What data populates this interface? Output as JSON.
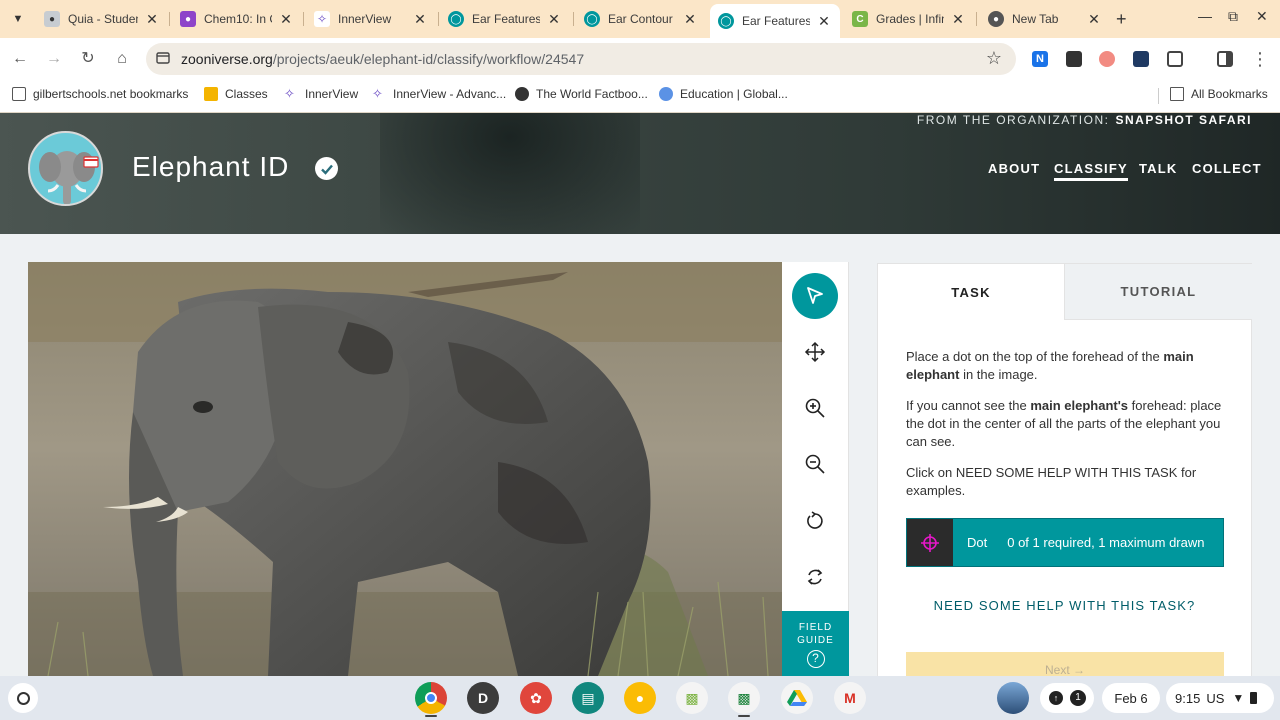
{
  "browser": {
    "tabs": [
      {
        "title": "Quia - Studen",
        "favicon": "quia-icon",
        "color": "#7a8a9a"
      },
      {
        "title": "Chem10: In C",
        "favicon": "classroom-icon",
        "color": "#8e44c9"
      },
      {
        "title": "InnerView",
        "favicon": "innerview-icon",
        "color": "#6a4bc4"
      },
      {
        "title": "Ear Features",
        "favicon": "zooniverse-icon",
        "color": "#00979d"
      },
      {
        "title": "Ear Contour",
        "favicon": "zooniverse-icon",
        "color": "#00979d"
      },
      {
        "title": "Ear Features",
        "favicon": "zooniverse-icon",
        "color": "#00979d",
        "active": true
      },
      {
        "title": "Grades | Infin",
        "favicon": "infinite-campus-icon",
        "color": "#7ab648"
      },
      {
        "title": "New Tab",
        "favicon": "chrome-icon",
        "color": "#555555"
      }
    ],
    "url_host": "zooniverse.org",
    "url_path": "/projects/aeuk/elephant-id/classify/workflow/24547",
    "bookmarks": [
      {
        "label": "gilbertschools.net bookmarks",
        "icon": "folder-link-icon"
      },
      {
        "label": "Classes",
        "icon": "classroom-icon"
      },
      {
        "label": "InnerView",
        "icon": "innerview-icon"
      },
      {
        "label": "InnerView - Advanc...",
        "icon": "innerview-icon"
      },
      {
        "label": "The World Factboo...",
        "icon": "cia-seal-icon"
      },
      {
        "label": "Education | Global...",
        "icon": "un-icon"
      }
    ],
    "all_bookmarks": "All Bookmarks"
  },
  "project": {
    "organization_prefix": "FROM THE ORGANIZATION:",
    "organization_name": "SNAPSHOT SAFARI",
    "title": "Elephant ID",
    "nav": [
      "ABOUT",
      "CLASSIFY",
      "TALK",
      "COLLECT"
    ],
    "active_nav": "CLASSIFY"
  },
  "viewer": {
    "tools": [
      "pointer-icon",
      "move-icon",
      "zoom-in-icon",
      "zoom-out-icon",
      "rotate-icon",
      "reset-icon"
    ],
    "field_guide_line1": "FIELD",
    "field_guide_line2": "GUIDE",
    "field_guide_q": "?"
  },
  "task": {
    "tab_task": "TASK",
    "tab_tutorial": "TUTORIAL",
    "p1_a": "Place a dot on the top of the forehead of the ",
    "p1_b": "main elephant",
    "p1_c": " in the image.",
    "p2_a": "If you cannot see the ",
    "p2_b": "main elephant's",
    "p2_c": " forehead: place the dot in the center of all the parts of the elephant you can see.",
    "p3": "Click on NEED SOME HELP WITH THIS TASK for examples.",
    "tool_label": "Dot",
    "tool_count": "0 of 1 required, 1 maximum drawn",
    "need_help": "NEED SOME HELP WITH THIS TASK?",
    "next": "Next →"
  },
  "shelf": {
    "apps": [
      {
        "name": "chrome-app",
        "letter": ""
      },
      {
        "name": "account-app",
        "letter": "D"
      },
      {
        "name": "canvas-app",
        "letter": ""
      },
      {
        "name": "classroom-app",
        "letter": ""
      },
      {
        "name": "keep-app",
        "letter": ""
      },
      {
        "name": "slides-app",
        "letter": ""
      },
      {
        "name": "classroom-green-app",
        "letter": ""
      },
      {
        "name": "drive-app",
        "letter": ""
      },
      {
        "name": "gmail-app",
        "letter": "M"
      }
    ],
    "notification_count": "1",
    "date": "Feb 6",
    "time": "9:15",
    "locale": "US"
  }
}
